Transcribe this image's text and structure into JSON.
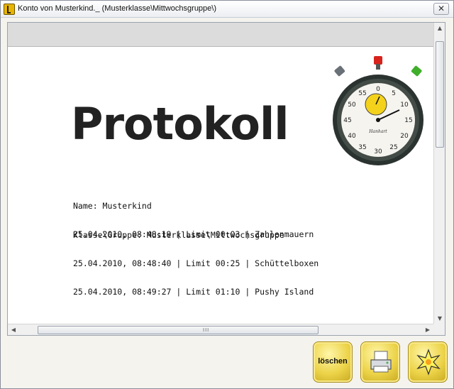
{
  "window": {
    "title": "Konto von Musterkind._ (Musterklasse\\Mittwochsgruppe\\)",
    "close_glyph": "✕"
  },
  "protocol": {
    "heading": "Protokoll",
    "name_line": "Name: Musterkind",
    "group_line": "Klasse\\Gruppe: Musterklasse\\Mittwochsgruppe",
    "entries": [
      "25.04.2010, 08:48:19 | Limit 00:03 | Zahlenmauern",
      "25.04.2010, 08:48:40 | Limit 00:25 | Schüttelboxen",
      "25.04.2010, 08:49:27 | Limit 01:10 | Pushy Island"
    ]
  },
  "stopwatch": {
    "dial_numbers": [
      "0",
      "5",
      "10",
      "15",
      "20",
      "25",
      "30",
      "35",
      "40",
      "45",
      "50",
      "55"
    ],
    "brand": "Hanhart",
    "crown_colors": {
      "center": "#d8231c",
      "right": "#3fae2a",
      "left": "#6a7077"
    }
  },
  "scrollbars": {
    "up_glyph": "▲",
    "down_glyph": "▼",
    "left_glyph": "◀",
    "right_glyph": "▶",
    "grip_glyph": "III"
  },
  "buttons": {
    "delete_label": "löschen",
    "print_icon": "printer-icon",
    "new_icon": "starburst-icon"
  },
  "colors": {
    "button_yellow": "#ecd348",
    "band_gray": "#dcdcdc"
  }
}
